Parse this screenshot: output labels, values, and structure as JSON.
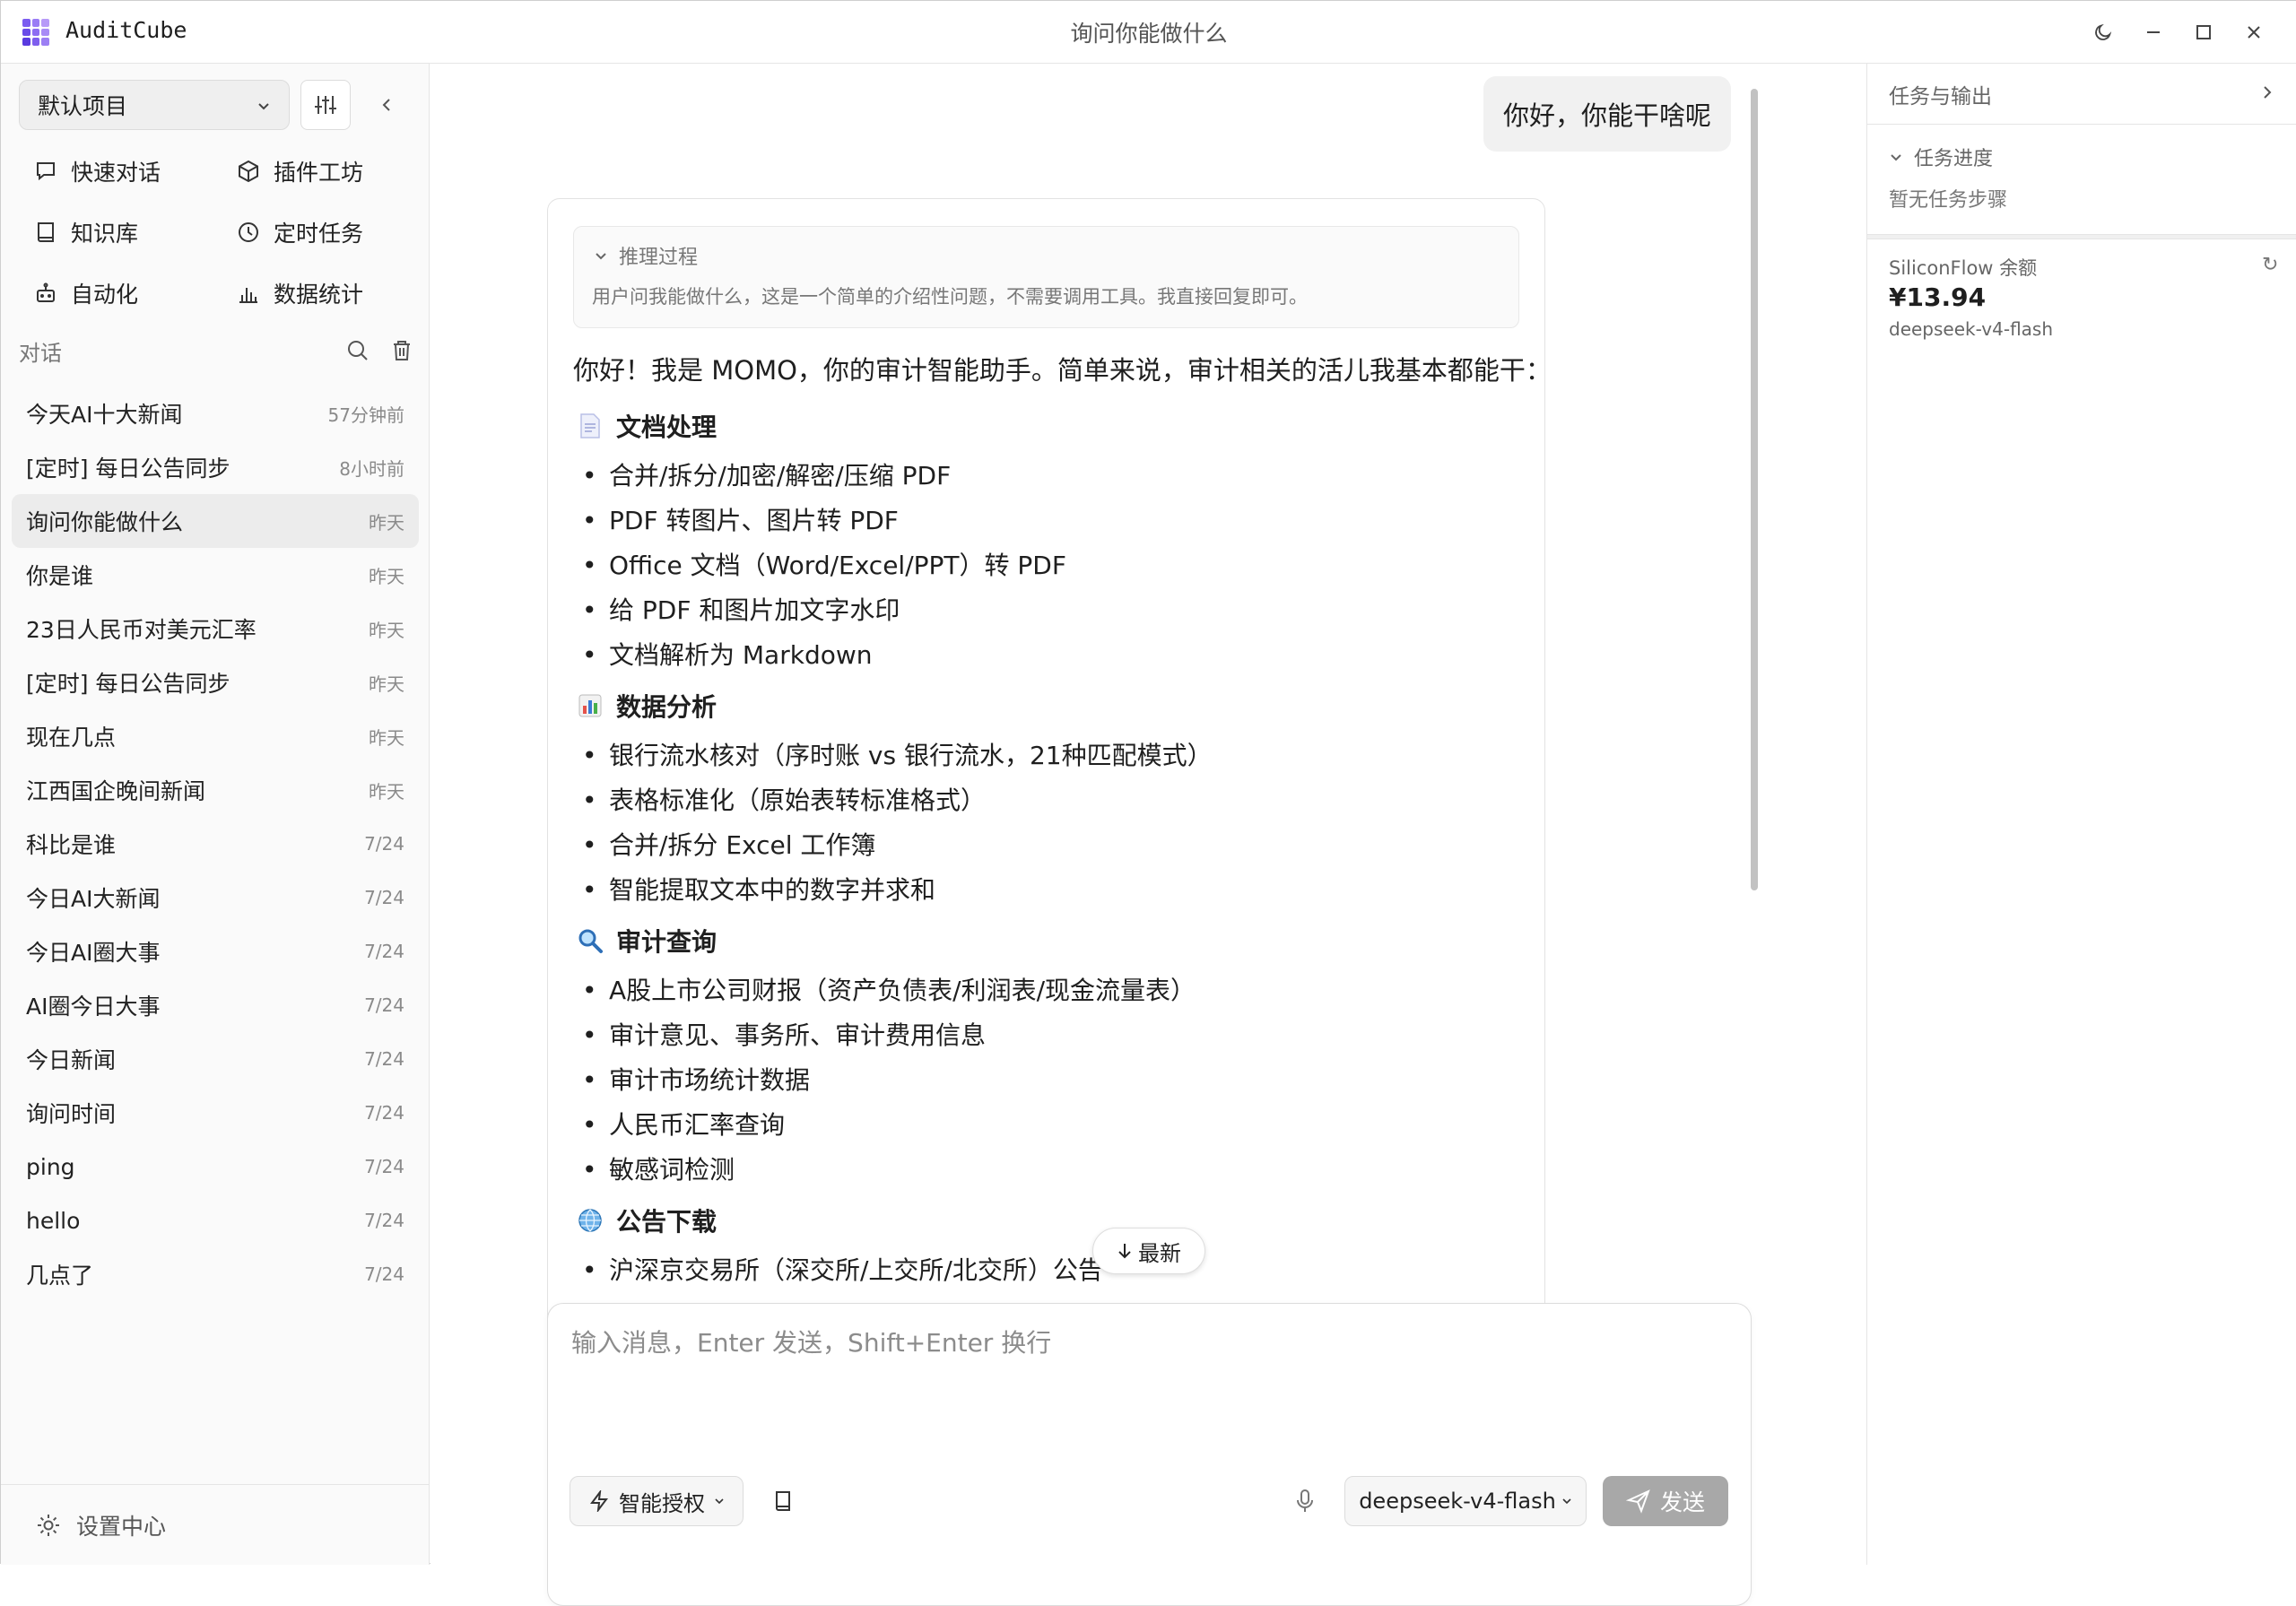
{
  "app": {
    "name": "AuditCube",
    "window_title": "询问你能做什么",
    "logo_colors": [
      "#7b5cf0",
      "#9a7cf5",
      "#b79af8",
      "#6a4be8",
      "#8d6df2",
      "#a88bf6",
      "#5a3be0",
      "#7e5eee",
      "#9c7ff4"
    ]
  },
  "sidebar": {
    "project": "默认项目",
    "nav": [
      {
        "label": "快速对话",
        "icon": "chat-bubble-icon"
      },
      {
        "label": "插件工坊",
        "icon": "cube-icon"
      },
      {
        "label": "知识库",
        "icon": "book-icon"
      },
      {
        "label": "定时任务",
        "icon": "clock-icon"
      },
      {
        "label": "自动化",
        "icon": "robot-icon"
      },
      {
        "label": "数据统计",
        "icon": "bar-chart-icon"
      }
    ],
    "conversations_label": "对话",
    "conversations": [
      {
        "title": "今天AI十大新闻",
        "time": "57分钟前",
        "active": false
      },
      {
        "title": "[定时] 每日公告同步",
        "time": "8小时前",
        "active": false
      },
      {
        "title": "询问你能做什么",
        "time": "昨天",
        "active": true
      },
      {
        "title": "你是谁",
        "time": "昨天",
        "active": false
      },
      {
        "title": "23日人民币对美元汇率",
        "time": "昨天",
        "active": false
      },
      {
        "title": "[定时] 每日公告同步",
        "time": "昨天",
        "active": false
      },
      {
        "title": "现在几点",
        "time": "昨天",
        "active": false
      },
      {
        "title": "江西国企晚间新闻",
        "time": "昨天",
        "active": false
      },
      {
        "title": "科比是谁",
        "time": "7/24",
        "active": false
      },
      {
        "title": "今日AI大新闻",
        "time": "7/24",
        "active": false
      },
      {
        "title": "今日AI圈大事",
        "time": "7/24",
        "active": false
      },
      {
        "title": "AI圈今日大事",
        "time": "7/24",
        "active": false
      },
      {
        "title": "今日新闻",
        "time": "7/24",
        "active": false
      },
      {
        "title": "询问时间",
        "time": "7/24",
        "active": false
      },
      {
        "title": "ping",
        "time": "7/24",
        "active": false
      },
      {
        "title": "hello",
        "time": "7/24",
        "active": false
      },
      {
        "title": "几点了",
        "time": "7/24",
        "active": false
      }
    ],
    "settings_label": "设置中心"
  },
  "chat": {
    "user_message": "你好，你能干啥呢",
    "reasoning_label": "推理过程",
    "reasoning_text": "用户问我能做什么，这是一个简单的介绍性问题，不需要调用工具。我直接回复即可。",
    "intro": "你好！我是 MOMO，你的审计智能助手。简单来说，审计相关的活儿我基本都能干：",
    "sections": [
      {
        "title": "文档处理",
        "icon": "document-emoji",
        "items": [
          "合并/拆分/加密/解密/压缩 PDF",
          "PDF 转图片、图片转 PDF",
          "Office 文档（Word/Excel/PPT）转 PDF",
          "给 PDF 和图片加文字水印",
          "文档解析为 Markdown"
        ]
      },
      {
        "title": "数据分析",
        "icon": "bar-chart-emoji",
        "items": [
          "银行流水核对（序时账 vs 银行流水，21种匹配模式）",
          "表格标准化（原始表转标准格式）",
          "合并/拆分 Excel 工作簿",
          "智能提取文本中的数字并求和"
        ]
      },
      {
        "title": "审计查询",
        "icon": "magnifier-emoji",
        "items": [
          "A股上市公司财报（资产负债表/利润表/现金流量表）",
          "审计意见、事务所、审计费用信息",
          "审计市场统计数据",
          "人民币汇率查询",
          "敏感词检测"
        ]
      },
      {
        "title": "公告下载",
        "icon": "globe-emoji",
        "items": [
          "沪深京交易所（深交所/上交所/北交所）公告"
        ]
      }
    ],
    "latest_label": "最新"
  },
  "composer": {
    "placeholder": "输入消息，Enter 发送，Shift+Enter 换行",
    "auth_label": "智能授权",
    "model": "deepseek-v4-flash",
    "send_label": "发送"
  },
  "right_panel": {
    "title": "任务与输出",
    "progress_label": "任务进度",
    "progress_empty": "暂无任务步骤",
    "balance_label": "SiliconFlow 余额",
    "balance_value": "¥13.94",
    "balance_model": "deepseek-v4-flash",
    "refresh_glyph": "↻"
  }
}
